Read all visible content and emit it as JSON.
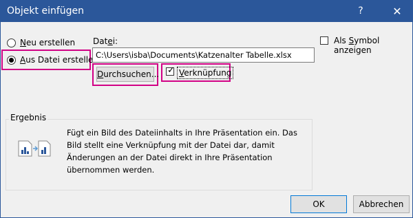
{
  "window": {
    "title": "Objekt einfügen",
    "help_label": "?",
    "close_label": "✕"
  },
  "options": {
    "new_label_prefix": "",
    "new_label_key": "N",
    "new_label_rest": "eu erstellen",
    "file_label_key": "A",
    "file_label_rest": "us Datei erstellen",
    "selected": "from-file"
  },
  "file": {
    "label_prefix": "Dat",
    "label_key": "e",
    "label_rest": "i:",
    "path": "C:\\Users\\isba\\Documents\\Katzenalter Tabelle.xlsx"
  },
  "buttons": {
    "browse_key": "D",
    "browse_rest": "urchsuchen...",
    "ok": "OK",
    "cancel": "Abbrechen"
  },
  "link_checkbox": {
    "key": "V",
    "rest": "erknüpfung",
    "checked": true
  },
  "symbol_checkbox": {
    "prefix": "Als ",
    "key": "S",
    "rest": "ymbol anzeigen",
    "checked": false
  },
  "result": {
    "title": "Ergebnis",
    "text": "Fügt ein Bild des Dateiinhalts in Ihre Präsentation ein. Das Bild stellt eine Verknüpfung mit der Datei dar, damit Änderungen an der Datei direkt in Ihre Präsentation übernommen werden."
  },
  "colors": {
    "titlebar": "#2b579a",
    "highlight": "#d10085",
    "accent": "#0078d7"
  },
  "icons": [
    "chart-file-icon",
    "arrow-icon",
    "linked-file-icon"
  ]
}
